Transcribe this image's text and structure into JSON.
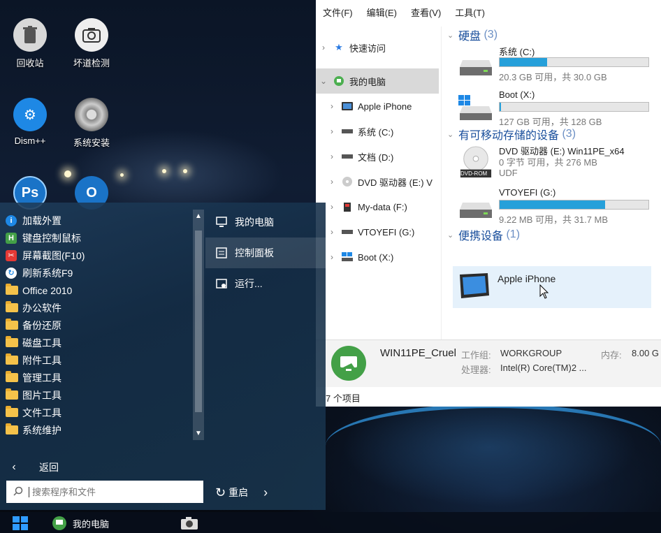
{
  "desktop": {
    "icons": [
      {
        "label": "回收站",
        "icon": "recycle-bin-icon"
      },
      {
        "label": "坏道检测",
        "icon": "disk-check-icon"
      },
      {
        "label": "Dism++",
        "icon": "dism-gear-icon"
      },
      {
        "label": "系统安装",
        "icon": "system-install-icon"
      },
      {
        "label": "Ps",
        "icon": "photoshop-icon"
      },
      {
        "label": "O",
        "icon": "outlook-icon"
      }
    ]
  },
  "explorer": {
    "menu": [
      "文件(F)",
      "编辑(E)",
      "查看(V)",
      "工具(T)"
    ],
    "nav": [
      {
        "label": "快速访问",
        "icon": "star-icon"
      },
      {
        "label": "我的电脑",
        "icon": "computer-icon"
      },
      {
        "label": "Apple iPhone",
        "icon": "phone-icon"
      },
      {
        "label": "系统 (C:)",
        "icon": "drive-icon"
      },
      {
        "label": "文档 (D:)",
        "icon": "drive-icon"
      },
      {
        "label": "DVD 驱动器 (E:) V",
        "icon": "dvd-icon"
      },
      {
        "label": "My-data (F:)",
        "icon": "usb-drive-icon"
      },
      {
        "label": "VTOYEFI (G:)",
        "icon": "drive-icon"
      },
      {
        "label": "Boot (X:)",
        "icon": "boot-drive-icon"
      }
    ],
    "groups": {
      "hdd": {
        "title": "硬盘",
        "count": "(3)"
      },
      "removable": {
        "title": "有可移动存储的设备",
        "count": "(3)"
      },
      "portable": {
        "title": "便携设备",
        "count": "(1)"
      }
    },
    "drives": [
      {
        "name": "系统 (C:)",
        "free": "20.3 GB 可用，共 30.0 GB",
        "used_fraction": 0.32
      },
      {
        "name": "Boot (X:)",
        "free": "127 GB 可用，共 128 GB",
        "used_fraction": 0.01
      },
      {
        "name": "DVD 驱动器 (E:) Win11PE_x64",
        "free": "0 字节 可用，共 276 MB",
        "extra": "UDF",
        "dvd_label": "DVD-ROM"
      },
      {
        "name": "VTOYEFI (G:)",
        "free": "9.22 MB 可用，共 31.7 MB",
        "used_fraction": 0.71
      }
    ],
    "portable_device": "Apple iPhone",
    "details": {
      "pc_name": "WIN11PE_Cruel",
      "workgroup_label": "工作组:",
      "workgroup": "WORKGROUP",
      "memory_label": "内存:",
      "memory": "8.00 G",
      "cpu_label": "处理器:",
      "cpu": "Intel(R) Core(TM)2 ..."
    },
    "status": "7 个项目"
  },
  "startmenu": {
    "programs": [
      {
        "label": "加载外置",
        "icon": "info-icon",
        "color": "#1e88e5",
        "glyph": "i"
      },
      {
        "label": "键盘控制鼠标",
        "icon": "keyboard-mouse-icon",
        "color": "#43a047",
        "glyph": "H"
      },
      {
        "label": "屏幕截图(F10)",
        "icon": "screenshot-icon",
        "color": "#e53935",
        "glyph": "✂"
      },
      {
        "label": "刷新系统F9",
        "icon": "refresh-icon",
        "color": "#fff",
        "glyph": "↻"
      },
      {
        "label": "Office 2010",
        "icon": "folder-icon"
      },
      {
        "label": "办公软件",
        "icon": "folder-icon"
      },
      {
        "label": "备份还原",
        "icon": "folder-icon"
      },
      {
        "label": "磁盘工具",
        "icon": "folder-icon"
      },
      {
        "label": "附件工具",
        "icon": "folder-icon"
      },
      {
        "label": "管理工具",
        "icon": "folder-icon"
      },
      {
        "label": "图片工具",
        "icon": "folder-icon"
      },
      {
        "label": "文件工具",
        "icon": "folder-icon"
      },
      {
        "label": "系统维护",
        "icon": "folder-icon"
      }
    ],
    "right": [
      {
        "label": "我的电脑",
        "icon": "monitor-icon"
      },
      {
        "label": "控制面板",
        "icon": "control-panel-icon"
      },
      {
        "label": "运行...",
        "icon": "run-icon"
      }
    ],
    "back": "返回",
    "search_placeholder": "搜索程序和文件",
    "restart": "重启"
  },
  "taskbar": {
    "mypc": "我的电脑"
  }
}
